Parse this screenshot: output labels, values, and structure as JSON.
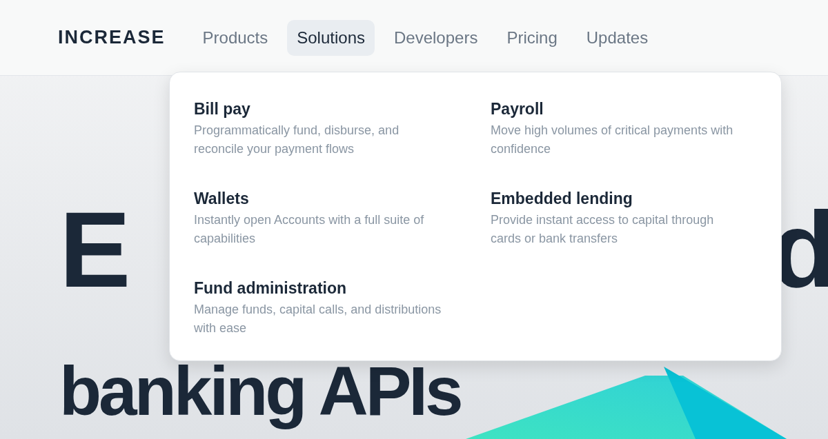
{
  "logo": "INCREASE",
  "nav": [
    {
      "label": "Products",
      "selected": false
    },
    {
      "label": "Solutions",
      "selected": true
    },
    {
      "label": "Developers",
      "selected": false
    },
    {
      "label": "Pricing",
      "selected": false
    },
    {
      "label": "Updates",
      "selected": false
    }
  ],
  "dropdown": {
    "items": [
      {
        "title": "Bill pay",
        "description": "Programmatically fund, disburse, and reconcile your payment flows"
      },
      {
        "title": "Payroll",
        "description": "Move high volumes of critical payments with confidence"
      },
      {
        "title": "Wallets",
        "description": "Instantly open Accounts with a full suite of capabilities"
      },
      {
        "title": "Embedded lending",
        "description": "Provide instant access to capital through cards or bank transfers"
      },
      {
        "title": "Fund administration",
        "description": "Manage funds, capital calls, and distributions with ease"
      }
    ]
  },
  "hero": {
    "line_1_start": "E",
    "line_1_end": "d",
    "line_2": "banking APIs"
  }
}
